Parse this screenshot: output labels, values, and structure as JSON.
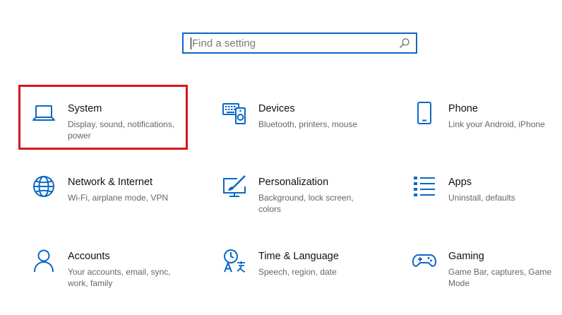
{
  "search": {
    "placeholder": "Find a setting",
    "value": ""
  },
  "colors": {
    "accent": "#0a68c6",
    "selection": "#d3181c",
    "title": "#111111",
    "description": "#666666"
  },
  "tiles": [
    {
      "title": "System",
      "desc": "Display, sound, notifications, power",
      "icon": "laptop-icon",
      "selected": true
    },
    {
      "title": "Devices",
      "desc": "Bluetooth, printers, mouse",
      "icon": "devices-icon",
      "selected": false
    },
    {
      "title": "Phone",
      "desc": "Link your Android, iPhone",
      "icon": "phone-icon",
      "selected": false
    },
    {
      "title": "Network & Internet",
      "desc": "Wi-Fi, airplane mode, VPN",
      "icon": "globe-icon",
      "selected": false
    },
    {
      "title": "Personalization",
      "desc": "Background, lock screen, colors",
      "icon": "paint-icon",
      "selected": false
    },
    {
      "title": "Apps",
      "desc": "Uninstall, defaults",
      "icon": "apps-list-icon",
      "selected": false
    },
    {
      "title": "Accounts",
      "desc": "Your accounts, email, sync, work, family",
      "icon": "person-icon",
      "selected": false
    },
    {
      "title": "Time & Language",
      "desc": "Speech, region, date",
      "icon": "time-language-icon",
      "selected": false
    },
    {
      "title": "Gaming",
      "desc": "Game Bar, captures, Game Mode",
      "icon": "gamepad-icon",
      "selected": false
    }
  ]
}
